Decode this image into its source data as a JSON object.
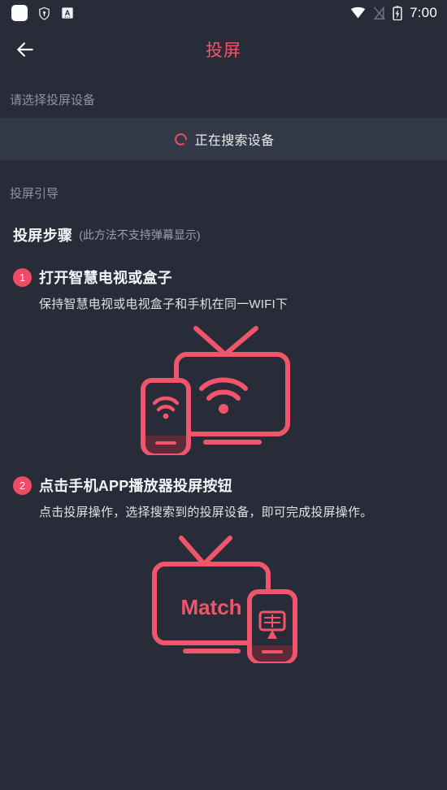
{
  "statusbar": {
    "icons_left": [
      "app-square-icon",
      "shield-icon",
      "letter-a-icon"
    ],
    "icons_right": [
      "wifi-icon",
      "no-sim-icon",
      "battery-charging-icon"
    ],
    "time": "7:00"
  },
  "header": {
    "back_icon": "back-arrow-icon",
    "title": "投屏",
    "title_color": "#f2556b"
  },
  "device_section": {
    "label": "请选择投屏设备",
    "searching_icon": "loading-spinner-icon",
    "searching_text": "正在搜索设备"
  },
  "guide_section": {
    "label": "投屏引导",
    "steps_title": "投屏步骤",
    "steps_note": "(此方法不支持弹幕显示)",
    "steps": [
      {
        "number": "1",
        "title": "打开智慧电视或盒子",
        "desc": "保持智慧电视或电视盒子和手机在同一WIFI下",
        "illustration": "tv-phone-wifi-illustration"
      },
      {
        "number": "2",
        "title": "点击手机APP播放器投屏按钮",
        "desc": "点击投屏操作，选择搜索到的投屏设备，即可完成投屏操作。",
        "illustration": "tv-match-phone-cast-illustration",
        "tv_screen_text": "Match",
        "phone_cast_label": "投屏"
      }
    ]
  },
  "colors": {
    "background": "#272c38",
    "row_background": "#333946",
    "accent": "#f2556b",
    "accent_badge": "#ef4b62",
    "muted_text": "#8d93a1",
    "primary_text": "#f3f4f7"
  }
}
